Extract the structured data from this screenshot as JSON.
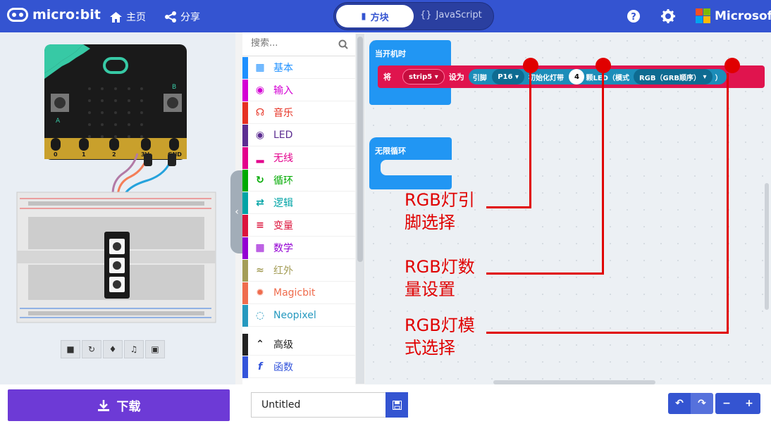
{
  "header": {
    "logo_text": "micro:bit",
    "home_label": "主页",
    "share_label": "分享",
    "blocks_tab": "方块",
    "js_tab": "JavaScript",
    "brand": "Microsoft"
  },
  "simulator": {
    "pins": [
      "0",
      "1",
      "2",
      "3V",
      "GND"
    ],
    "button_a": "A",
    "button_b": "B"
  },
  "toolbox": {
    "search_placeholder": "搜索...",
    "categories": [
      {
        "label": "基本",
        "icon": "grid-icon",
        "color": "#1e90ff"
      },
      {
        "label": "输入",
        "icon": "target-icon",
        "color": "#d400d4"
      },
      {
        "label": "音乐",
        "icon": "headphones-icon",
        "color": "#e63022"
      },
      {
        "label": "LED",
        "icon": "toggle-icon",
        "color": "#5c2d91"
      },
      {
        "label": "无线",
        "icon": "signal-icon",
        "color": "#e3008c"
      },
      {
        "label": "循环",
        "icon": "loop-icon",
        "color": "#00aa00"
      },
      {
        "label": "逻辑",
        "icon": "shuffle-icon",
        "color": "#00a4a6"
      },
      {
        "label": "变量",
        "icon": "lines-icon",
        "color": "#dc143c"
      },
      {
        "label": "数学",
        "icon": "calculator-icon",
        "color": "#9400d3"
      },
      {
        "label": "红外",
        "icon": "wifi-icon",
        "color": "#a49d57"
      },
      {
        "label": "Magicbit",
        "icon": "gear-icon",
        "color": "#ef6c4d"
      },
      {
        "label": "Neopixel",
        "icon": "ring-icon",
        "color": "#2699bf"
      }
    ],
    "advanced": "高级",
    "functions": "函数"
  },
  "workspace": {
    "on_start": "当开机时",
    "forever": "无限循环",
    "set_label": "将",
    "var_name": "strip5",
    "to_label": "设为",
    "pin_label": "引脚",
    "pin_value": "P16",
    "init_label": "初始化灯带",
    "led_count": "4",
    "mode_label": "颗LED（模式",
    "mode_value": "RGB（GRB顺序）",
    "close_paren": "）"
  },
  "annotations": {
    "a1_line1": "RGB灯引",
    "a1_line2": "脚选择",
    "a2_line1": "RGB灯数",
    "a2_line2": "量设置",
    "a3_line1": "RGB灯模",
    "a3_line2": "式选择"
  },
  "bottom": {
    "download": "下载",
    "project_name": "Untitled"
  }
}
